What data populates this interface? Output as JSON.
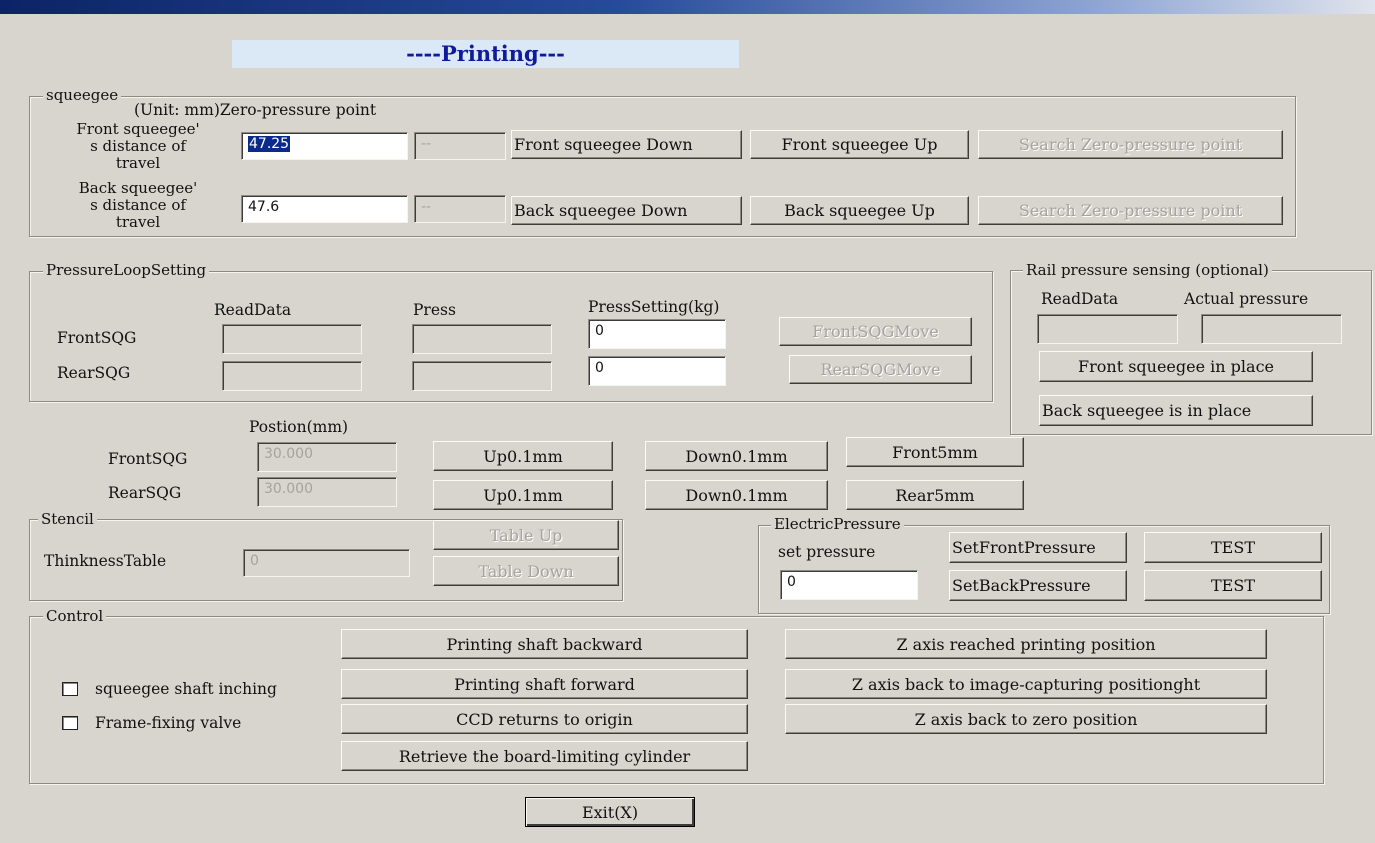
{
  "window": {
    "title": "----Printing---"
  },
  "squeegee": {
    "legend": "squeegee",
    "unit_label": "(Unit: mm)Zero-pressure point",
    "front": {
      "label_line1": "Front squeegee'",
      "label_line2": "s distance of",
      "label_line3": "travel",
      "value": "47.25",
      "zero_point": "--",
      "down_button": "Front squeegee Down",
      "up_button": "Front squeegee Up",
      "search_button": "Search Zero-pressure point"
    },
    "back": {
      "label_line1": "Back squeegee'",
      "label_line2": "s distance of",
      "label_line3": "travel",
      "value": "47.6",
      "zero_point": "--",
      "down_button": "Back squeegee Down",
      "up_button": "Back squeegee Up",
      "search_button": "Search Zero-pressure point"
    }
  },
  "pressure_loop": {
    "legend": "PressureLoopSetting",
    "col_read": "ReadData",
    "col_press": "Press",
    "col_setting": "PressSetting(kg)",
    "front": {
      "label": "FrontSQG",
      "read": "",
      "press": "",
      "setting": "0",
      "move_button": "FrontSQGMove"
    },
    "rear": {
      "label": "RearSQG",
      "read": "",
      "press": "",
      "setting": "0",
      "move_button": "RearSQGMove"
    }
  },
  "rail": {
    "legend": "Rail pressure sensing (optional)",
    "col_read": "ReadData",
    "col_actual": "Actual pressure",
    "read": "",
    "actual": "",
    "front_button": "Front squeegee in place",
    "back_button": "Back squeegee is in place"
  },
  "position": {
    "header": "Postion(mm)",
    "front": {
      "label": "FrontSQG",
      "value": "30.000",
      "up": "Up0.1mm",
      "down": "Down0.1mm",
      "move": "Front5mm"
    },
    "rear": {
      "label": "RearSQG",
      "value": "30.000",
      "up": "Up0.1mm",
      "down": "Down0.1mm",
      "move": "Rear5mm"
    }
  },
  "stencil": {
    "legend": "Stencil",
    "thickness_label": "ThinknessTable",
    "thickness_value": "0",
    "table_up": "Table Up",
    "table_down": "Table Down"
  },
  "electric": {
    "legend": "ElectricPressure",
    "set_label": "set pressure",
    "value": "0",
    "front_button": "SetFrontPressure",
    "back_button": "SetBackPressure",
    "test_button": "TEST"
  },
  "control": {
    "legend": "Control",
    "checkbox_inching": "squeegee shaft inching",
    "checkbox_frame": "Frame-fixing valve",
    "btn_backward": "Printing shaft backward",
    "btn_forward": "Printing shaft forward",
    "btn_ccd": "CCD returns to origin",
    "btn_retrieve": "Retrieve the board-limiting cylinder",
    "btn_z_print": "Z axis reached printing position",
    "btn_z_image": "Z axis back to image-capturing positionght",
    "btn_z_zero": "Z axis back to zero position"
  },
  "exit_button": "Exit(X)"
}
